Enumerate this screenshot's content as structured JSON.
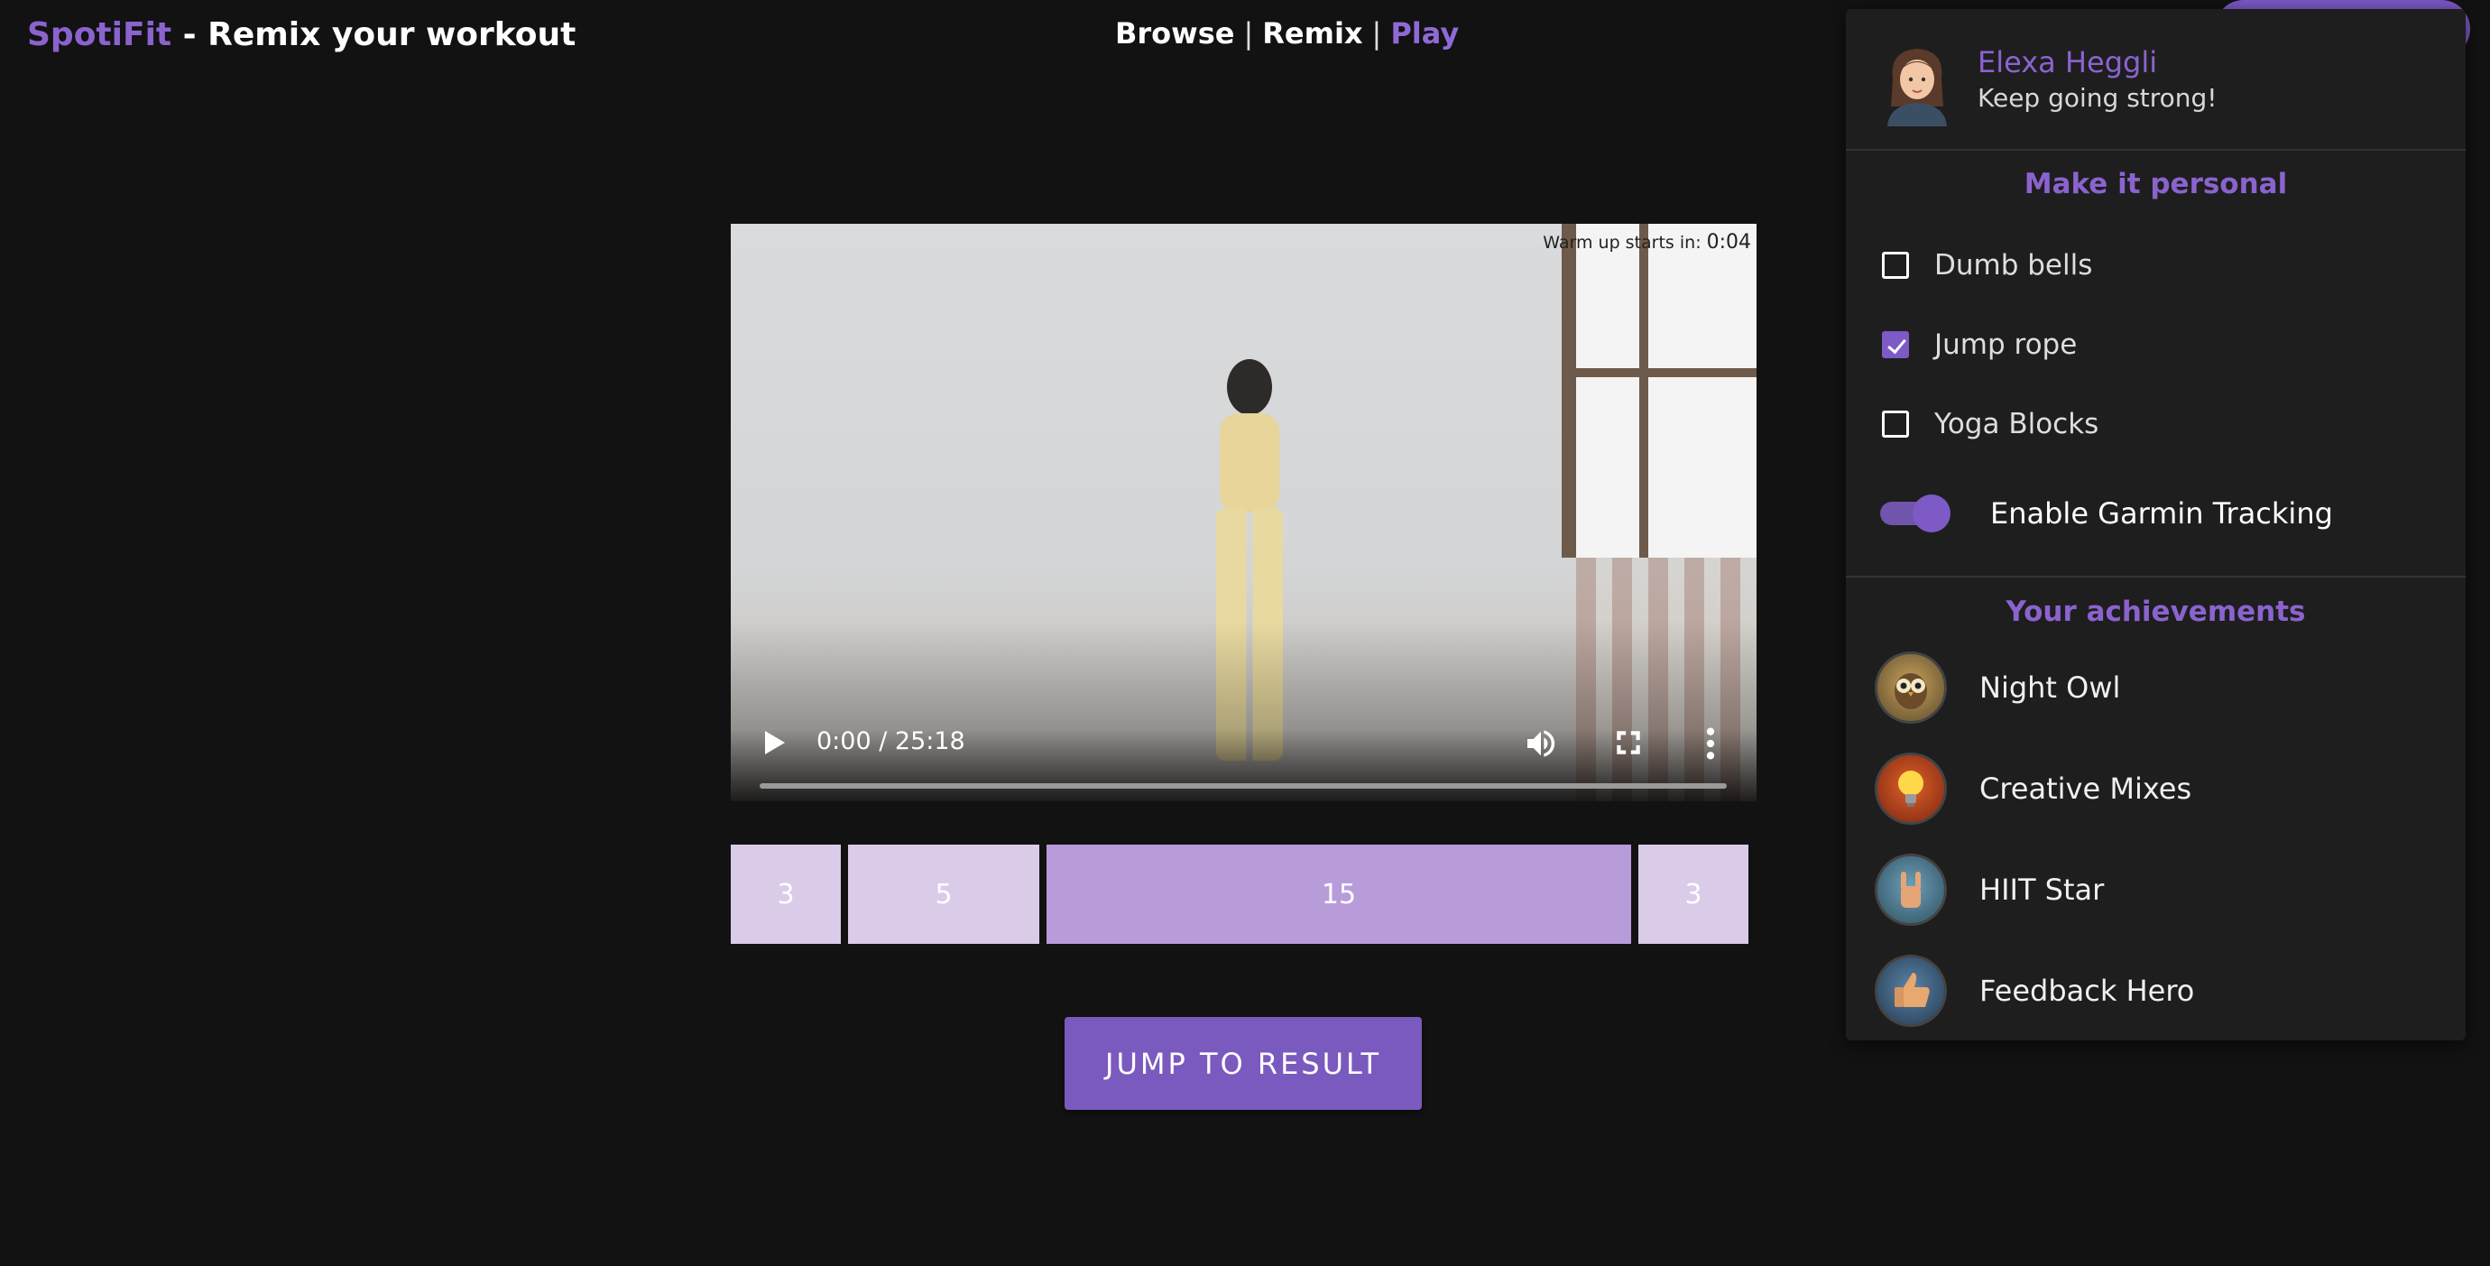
{
  "header": {
    "brand": "SpotiFit",
    "title_rest": " - Remix your workout"
  },
  "nav": {
    "items": [
      "Browse",
      "Remix",
      "Play"
    ],
    "separator": "|",
    "active": "Play"
  },
  "video": {
    "overlay_label": "Warm up starts in:",
    "overlay_time": "0:04",
    "time_display": "0:00 / 25:18",
    "progress": 0.0
  },
  "segments": [
    "3",
    "5",
    "15",
    "3"
  ],
  "jump_button": "JUMP TO RESULT",
  "profile": {
    "name": "Elexa Heggli",
    "status": "Keep going strong!",
    "personal_title": "Make it personal",
    "equipment": [
      {
        "label": "Dumb bells",
        "checked": false
      },
      {
        "label": "Jump rope",
        "checked": true
      },
      {
        "label": "Yoga Blocks",
        "checked": false
      }
    ],
    "garmin_toggle": {
      "label": "Enable Garmin Tracking",
      "on": true
    },
    "achievements_title": "Your achievements",
    "achievements": [
      {
        "label": "Night Owl",
        "icon": "owl-icon"
      },
      {
        "label": "Creative Mixes",
        "icon": "lightbulb-icon"
      },
      {
        "label": "HIIT Star",
        "icon": "rock-hand-icon"
      },
      {
        "label": "Feedback Hero",
        "icon": "thumbs-up-icon"
      }
    ]
  },
  "colors": {
    "accent": "#8b63cf",
    "button": "#7b5abf",
    "segment_light": "#dacbe9",
    "segment_mid": "#b89cda",
    "background": "#121212",
    "panel": "#1e1e1e"
  }
}
